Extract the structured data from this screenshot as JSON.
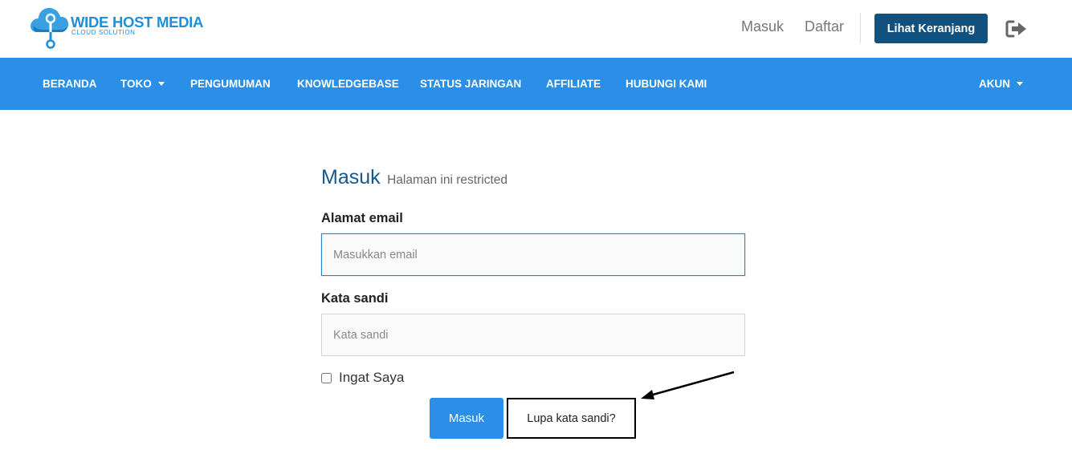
{
  "brand": {
    "name": "WIDE HOST MEDIA",
    "tagline": "CLOUD SOLUTION",
    "color": "#1f8fd8"
  },
  "header": {
    "login_link": "Masuk",
    "register_link": "Daftar",
    "cart_button": "Lihat Keranjang",
    "logout_icon": "sign-out-icon"
  },
  "nav": {
    "items": [
      {
        "label": "BERANDA",
        "dropdown": false
      },
      {
        "label": "TOKO",
        "dropdown": true
      },
      {
        "label": "PENGUMUMAN",
        "dropdown": false
      },
      {
        "label": "KNOWLEDGEBASE",
        "dropdown": false
      },
      {
        "label": "STATUS JARINGAN",
        "dropdown": false
      },
      {
        "label": "AFFILIATE",
        "dropdown": false
      },
      {
        "label": "HUBUNGI KAMI",
        "dropdown": false
      }
    ],
    "account": {
      "label": "AKUN",
      "dropdown": true
    },
    "color": "#2b8fe8"
  },
  "login": {
    "title": "Masuk",
    "subtitle": "Halaman ini restricted",
    "email_label": "Alamat email",
    "email_placeholder": "Masukkan email",
    "email_value": "",
    "password_label": "Kata sandi",
    "password_placeholder": "Kata sandi",
    "password_value": "",
    "remember_label": "Ingat Saya",
    "remember_checked": false,
    "submit_button": "Masuk",
    "forgot_link": "Lupa kata sandi?"
  },
  "colors": {
    "primary": "#2b8fe8",
    "dark_button": "#12517e",
    "heading": "#15588b"
  }
}
